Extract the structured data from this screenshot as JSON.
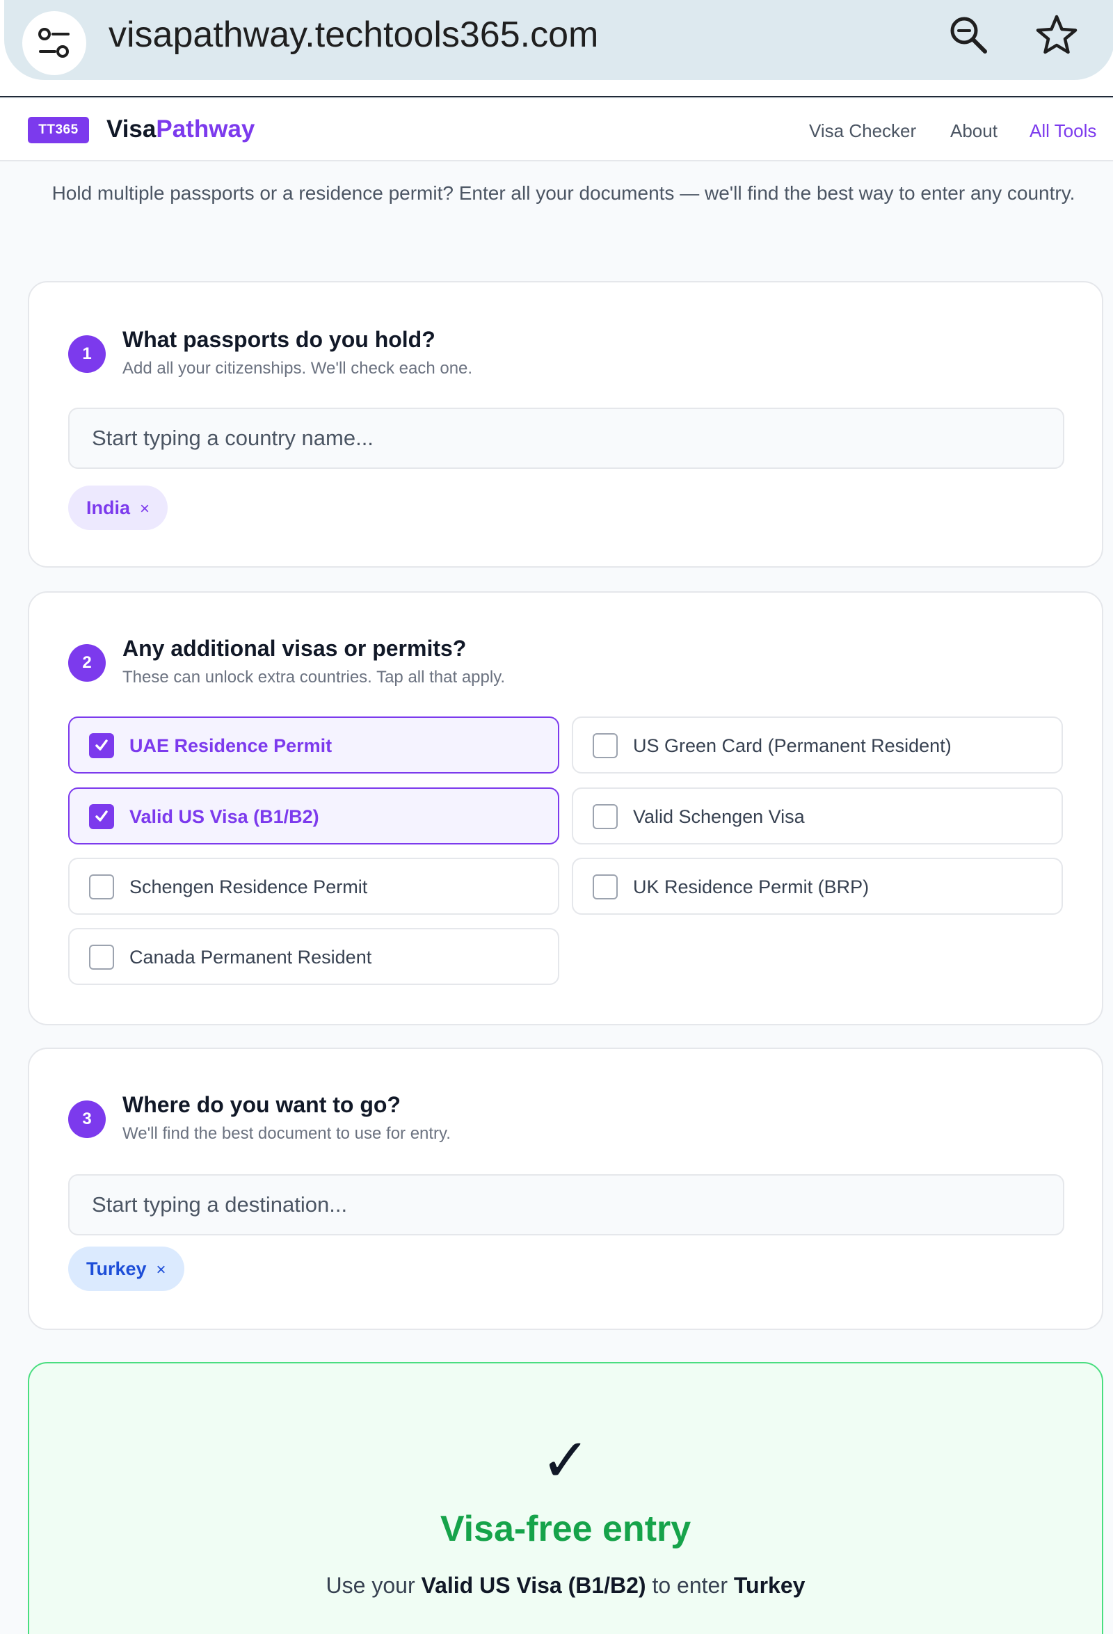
{
  "browser": {
    "url": "visapathway.techtools365.com",
    "icons": [
      "tune-icon",
      "zoom-icon",
      "star-icon"
    ]
  },
  "header": {
    "badge": "TT365",
    "brand_part1": "Visa",
    "brand_part2": "Pathway",
    "nav": [
      {
        "label": "Visa Checker",
        "active": false
      },
      {
        "label": "About",
        "active": false
      },
      {
        "label": "All Tools",
        "active": true
      }
    ]
  },
  "intro": "Hold multiple passports or a residence permit? Enter all your documents — we'll find the best way to enter any country.",
  "step1": {
    "number": "1",
    "title": "What passports do you hold?",
    "subtitle": "Add all your citizenships. We'll check each one.",
    "placeholder": "Start typing a country name...",
    "chips": [
      {
        "label": "India",
        "remove": "×"
      }
    ]
  },
  "step2": {
    "number": "2",
    "title": "Any additional visas or permits?",
    "subtitle": "These can unlock extra countries. Tap all that apply.",
    "options": [
      {
        "label": "UAE Residence Permit",
        "checked": true
      },
      {
        "label": "US Green Card (Permanent Resident)",
        "checked": false
      },
      {
        "label": "Valid US Visa (B1/B2)",
        "checked": true
      },
      {
        "label": "Valid Schengen Visa",
        "checked": false
      },
      {
        "label": "Schengen Residence Permit",
        "checked": false
      },
      {
        "label": "UK Residence Permit (BRP)",
        "checked": false
      },
      {
        "label": "Canada Permanent Resident",
        "checked": false
      }
    ]
  },
  "step3": {
    "number": "3",
    "title": "Where do you want to go?",
    "subtitle": "We'll find the best document to use for entry.",
    "placeholder": "Start typing a destination...",
    "chips": [
      {
        "label": "Turkey",
        "remove": "×"
      }
    ]
  },
  "result": {
    "check": "✓",
    "title": "Visa-free entry",
    "prefix": "Use your",
    "document": "Valid US Visa (B1/B2)",
    "middle": "to enter",
    "destination": "Turkey"
  },
  "colors": {
    "accent": "#7c3aed",
    "success": "#16a34a",
    "chip_blue": "#1d4ed8"
  }
}
